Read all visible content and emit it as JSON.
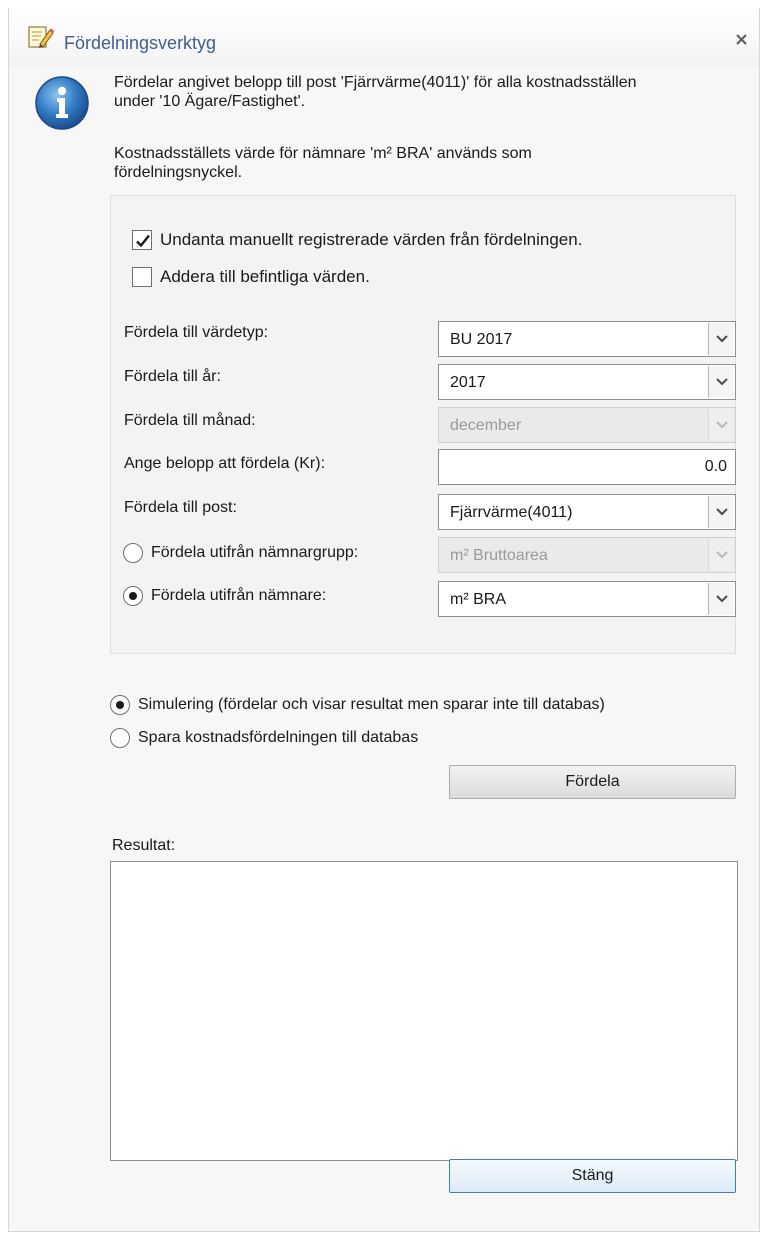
{
  "window": {
    "title": "Fördelningsverktyg",
    "app_icon": "edit-notepad-icon",
    "close_icon": "close-icon"
  },
  "info": {
    "icon": "info-icon",
    "line1": "Fördelar angivet belopp till post 'Fjärrvärme(4011)' för alla kostnadsställen",
    "line2": "under '10 Ägare/Fastighet'.",
    "line3": "Kostnadsställets värde för nämnare 'm² BRA' används som",
    "line4": "fördelningsnyckel."
  },
  "options": {
    "exclude_manual": {
      "label": "Undanta manuellt registrerade värden från fördelningen.",
      "checked": true
    },
    "add_existing": {
      "label": "Addera till befintliga värden.",
      "checked": false
    }
  },
  "fields": {
    "value_type": {
      "label": "Fördela till värdetyp:",
      "value": "BU 2017"
    },
    "year": {
      "label": "Fördela till år:",
      "value": "2017"
    },
    "month": {
      "label": "Fördela till månad:",
      "value": "december",
      "disabled": true
    },
    "amount": {
      "label": "Ange belopp att fördela (Kr):",
      "value": "0.0"
    },
    "post": {
      "label": "Fördela till post:",
      "value": "Fjärrvärme(4011)"
    },
    "denominator_group": {
      "label": "Fördela utifrån  nämnargrupp:",
      "value": "m² Bruttoarea",
      "selected": false,
      "disabled": true
    },
    "denominator": {
      "label": "Fördela utifrån nämnare:",
      "value": "m² BRA",
      "selected": true
    }
  },
  "mode": {
    "simulate": {
      "label": "Simulering (fördelar och visar resultat men sparar inte till databas)",
      "selected": true
    },
    "save": {
      "label": "Spara kostnadsfördelningen till databas",
      "selected": false
    }
  },
  "buttons": {
    "distribute": "Fördela",
    "close": "Stäng"
  },
  "result": {
    "label": "Resultat:",
    "text": ""
  },
  "colors": {
    "title_text": "#3d5f8a",
    "info_icon": "#2f78c2",
    "primary_border": "#3c7fb1"
  }
}
